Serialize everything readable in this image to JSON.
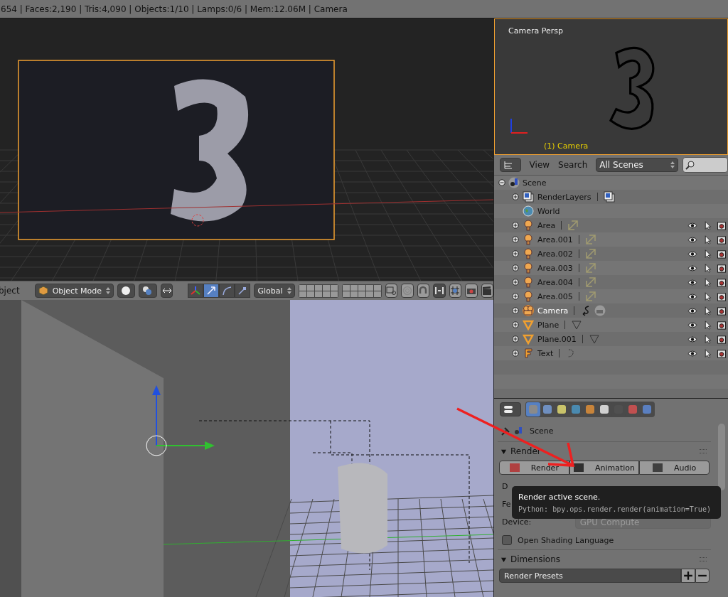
{
  "info_bar": {
    "text": "654 | Faces:2,190 | Tris:4,090 | Objects:1/10 | Lamps:0/6 | Mem:12.06M | Camera"
  },
  "camera_view": {
    "label": "Camera Persp",
    "object_label": "(1) Camera"
  },
  "view3d_header": {
    "menu_label": "bject",
    "mode": "Object Mode",
    "orientation": "Global",
    "manipulators": [
      {
        "kind": "axes",
        "selected": false
      },
      {
        "kind": "translate",
        "selected": true
      },
      {
        "kind": "rotate",
        "selected": false
      },
      {
        "kind": "scale",
        "selected": false
      }
    ]
  },
  "outliner": {
    "menus": [
      "View",
      "Search"
    ],
    "filter": "All Scenes",
    "tree": [
      {
        "name": "Scene",
        "kind": "scene",
        "expanded": true,
        "children": [
          {
            "name": "RenderLayers",
            "kind": "renderlayers",
            "expanded": false,
            "restrict": false
          },
          {
            "name": "World",
            "kind": "world",
            "restrict": false
          },
          {
            "name": "Area",
            "kind": "lamp",
            "expanded": false,
            "restrict": true,
            "active": false
          },
          {
            "name": "Area.001",
            "kind": "lamp",
            "expanded": false,
            "restrict": true,
            "active": false
          },
          {
            "name": "Area.002",
            "kind": "lamp",
            "expanded": false,
            "restrict": true,
            "active": false
          },
          {
            "name": "Area.003",
            "kind": "lamp",
            "expanded": false,
            "restrict": true,
            "active": false
          },
          {
            "name": "Area.004",
            "kind": "lamp",
            "expanded": false,
            "restrict": true,
            "active": false
          },
          {
            "name": "Area.005",
            "kind": "lamp",
            "expanded": false,
            "restrict": true,
            "active": false
          },
          {
            "name": "Camera",
            "kind": "camera",
            "expanded": false,
            "restrict": true,
            "active": true
          },
          {
            "name": "Plane",
            "kind": "mesh",
            "expanded": false,
            "restrict": true,
            "active": false
          },
          {
            "name": "Plane.001",
            "kind": "mesh",
            "expanded": false,
            "restrict": true,
            "active": false
          },
          {
            "name": "Text",
            "kind": "font",
            "expanded": false,
            "restrict": true,
            "active": false
          }
        ]
      }
    ]
  },
  "properties": {
    "tabs": [
      {
        "kind": "render",
        "selected": true
      },
      {
        "kind": "render_layers",
        "selected": false
      },
      {
        "kind": "scene",
        "selected": false
      },
      {
        "kind": "world",
        "selected": false
      },
      {
        "kind": "object",
        "selected": false
      },
      {
        "kind": "constraints",
        "selected": false
      },
      {
        "kind": "object_data",
        "selected": false
      },
      {
        "kind": "texture",
        "selected": false
      },
      {
        "kind": "physics",
        "selected": false
      }
    ],
    "context": "Scene",
    "render_panel": {
      "title": "Render",
      "expanded": true,
      "buttons": [
        {
          "label": "Render",
          "kind": "still"
        },
        {
          "label": "Animation",
          "kind": "animation"
        },
        {
          "label": "Audio",
          "kind": "audio"
        }
      ],
      "fields": [
        {
          "label": "D"
        },
        {
          "label": "Fe"
        },
        {
          "label": "Device:",
          "value": "GPU Compute",
          "disabled": true
        }
      ],
      "checkbox": {
        "label": "Open Shading Language",
        "checked": false
      }
    },
    "dimensions_panel": {
      "title": "Dimensions",
      "expanded": true,
      "preset": "Render Presets"
    }
  },
  "tooltip": {
    "title": "Render active scene.",
    "python": "Python: bpy.ops.render.render(animation=True)"
  }
}
